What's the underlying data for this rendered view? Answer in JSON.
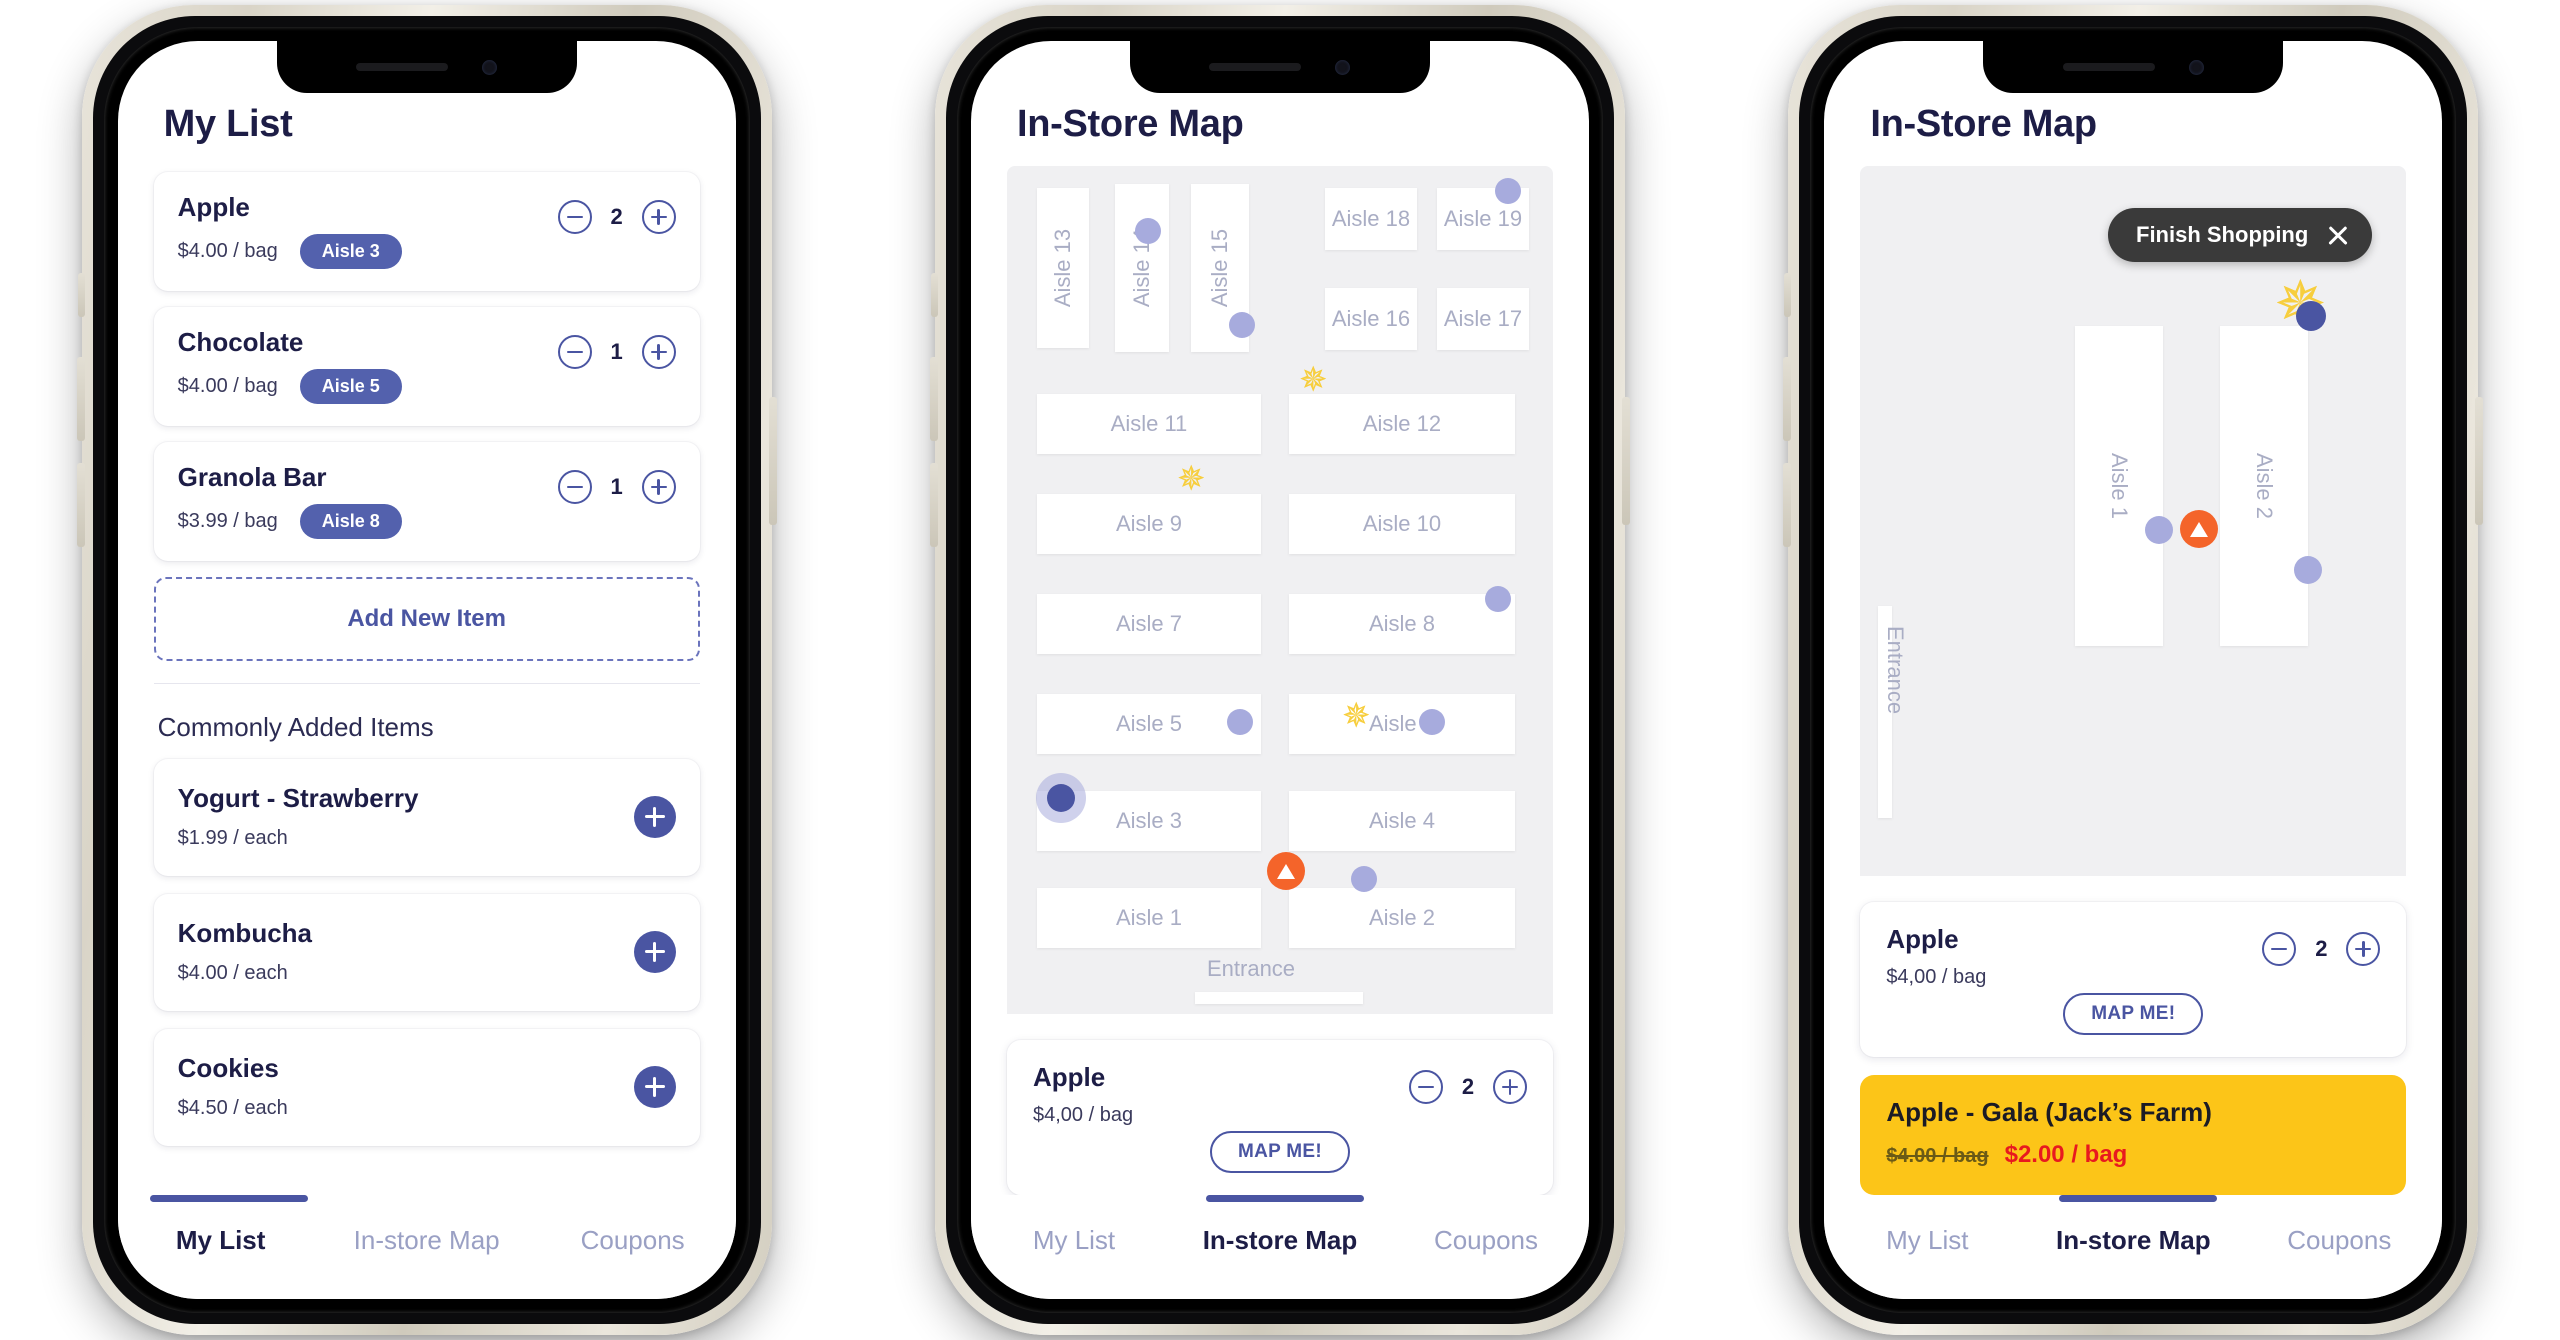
{
  "phones": {
    "list_screen": {
      "title": "My List",
      "items": [
        {
          "name": "Apple",
          "price": "$4.00 / bag",
          "aisle": "Aisle 3",
          "qty": "2"
        },
        {
          "name": "Chocolate",
          "price": "$4.00 / bag",
          "aisle": "Aisle 5",
          "qty": "1"
        },
        {
          "name": "Granola Bar",
          "price": "$3.99 / bag",
          "aisle": "Aisle 8",
          "qty": "1"
        }
      ],
      "add_new_label": "Add New Item",
      "section_title": "Commonly Added Items",
      "suggestions": [
        {
          "name": "Yogurt - Strawberry",
          "price": "$1.99 / each"
        },
        {
          "name": "Kombucha",
          "price": "$4.00 / each"
        },
        {
          "name": "Cookies",
          "price": "$4.50 / each"
        }
      ],
      "tabs": [
        {
          "label": "My List",
          "active": true
        },
        {
          "label": "In-store Map",
          "active": false
        },
        {
          "label": "Coupons",
          "active": false
        }
      ]
    },
    "map_screen": {
      "title": "In-Store Map",
      "aisles": [
        "Aisle 13",
        "Aisle 14",
        "Aisle 15",
        "Aisle 18",
        "Aisle 19",
        "Aisle 16",
        "Aisle 17",
        "Aisle 11",
        "Aisle 12",
        "Aisle 9",
        "Aisle 10",
        "Aisle 7",
        "Aisle 8",
        "Aisle 5",
        "Aisle 6",
        "Aisle 3",
        "Aisle 4",
        "Aisle 1",
        "Aisle 2"
      ],
      "entrance_label": "Entrance",
      "detail": {
        "name": "Apple",
        "price": "$4,00 / bag",
        "qty": "2",
        "map_me_label": "MAP ME!"
      },
      "tabs": [
        {
          "label": "My List",
          "active": false
        },
        {
          "label": "In-store Map",
          "active": true
        },
        {
          "label": "Coupons",
          "active": false
        }
      ]
    },
    "zoom_screen": {
      "title": "In-Store Map",
      "finish_label": "Finish Shopping",
      "aisles": [
        "Aisle 1",
        "Aisle 2"
      ],
      "entrance_label": "Entrance",
      "detail": {
        "name": "Apple",
        "price": "$4,00 / bag",
        "qty": "2",
        "map_me_label": "MAP ME!"
      },
      "promo": {
        "name": "Apple - Gala (Jack’s Farm)",
        "old_price": "$4.00 / bag",
        "new_price": "$2.00 / bag"
      },
      "tabs": [
        {
          "label": "My List",
          "active": false
        },
        {
          "label": "In-store Map",
          "active": true
        },
        {
          "label": "Coupons",
          "active": false
        }
      ]
    }
  },
  "colors": {
    "brand": "#4a55a2",
    "pill": "#5361ad",
    "text_dark": "#1d1d46",
    "muted": "#9aa0c4",
    "map_bg": "#f0f0f2",
    "marker_orange": "#f4642a",
    "star_yellow": "#f7ce3e",
    "promo_yellow": "#fcc518",
    "promo_red": "#e8191f"
  }
}
